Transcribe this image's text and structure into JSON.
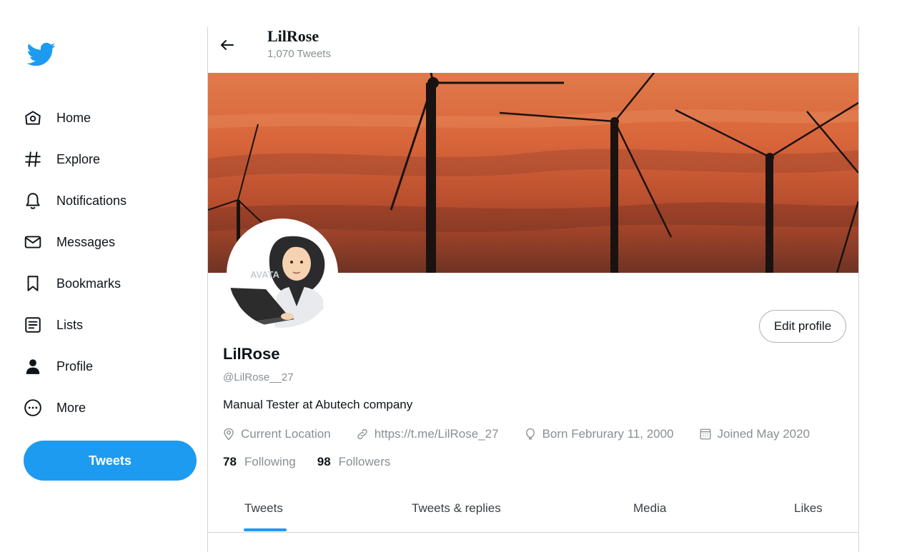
{
  "sidebar": {
    "logo_icon": "twitter-bird-icon",
    "items": [
      {
        "label": "Home",
        "icon": "home-icon"
      },
      {
        "label": "Explore",
        "icon": "hashtag-icon"
      },
      {
        "label": "Notifications",
        "icon": "bell-icon"
      },
      {
        "label": "Messages",
        "icon": "envelope-icon"
      },
      {
        "label": "Bookmarks",
        "icon": "bookmark-icon"
      },
      {
        "label": "Lists",
        "icon": "list-icon"
      },
      {
        "label": "Profile",
        "icon": "person-icon"
      },
      {
        "label": "More",
        "icon": "more-circle-icon"
      }
    ],
    "tweet_button_label": "Tweets"
  },
  "header": {
    "title": "LilRose",
    "subtitle": "1,070 Tweets",
    "back_icon": "arrow-left-icon"
  },
  "profile": {
    "display_name": "LilRose",
    "handle": "@LilRose__27",
    "bio": "Manual Tester at Abutech company",
    "edit_button_label": "Edit profile",
    "avatar_watermark": "AVATA",
    "meta": {
      "location": "Current Location",
      "website": "https://t.me/LilRose_27",
      "birthday": "Born Februrary 11, 2000",
      "joined": "Joined May 2020"
    },
    "following_count": "78",
    "following_label": "Following",
    "followers_count": "98",
    "followers_label": "Followers"
  },
  "tabs": [
    {
      "label": "Tweets",
      "active": true
    },
    {
      "label": "Tweets & replies",
      "active": false
    },
    {
      "label": "Media",
      "active": false
    },
    {
      "label": "Likes",
      "active": false
    }
  ],
  "colors": {
    "accent": "#1d9bf0",
    "muted_text": "#8a8f94",
    "primary_text": "#0f1419",
    "border": "#d0d4d8"
  }
}
